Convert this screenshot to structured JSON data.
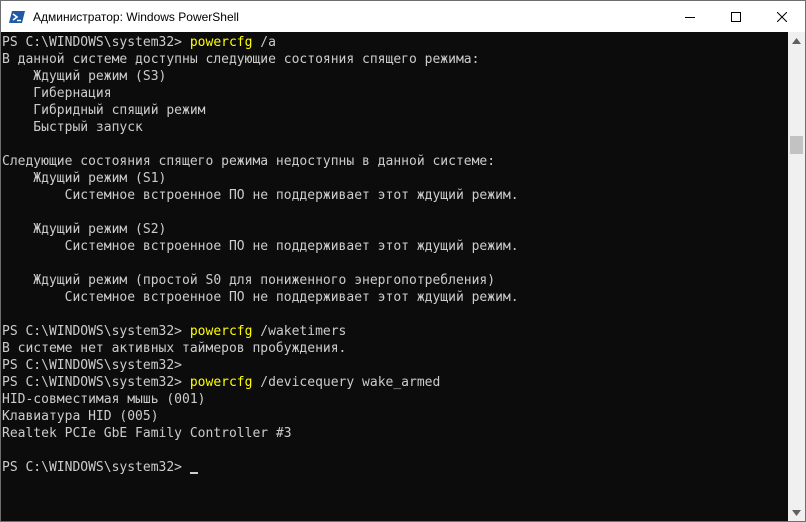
{
  "window": {
    "title": "Администратор: Windows PowerShell",
    "icon": "powershell-icon",
    "controls": [
      "minimize-icon",
      "maximize-icon",
      "close-icon"
    ]
  },
  "console": {
    "prompt": "PS C:\\WINDOWS\\system32> ",
    "lines": [
      {
        "type": "cmd",
        "prompt": "PS C:\\WINDOWS\\system32> ",
        "command": "powercfg",
        "args": " /a"
      },
      {
        "type": "text",
        "text": "В данной системе доступны следующие состояния спящего режима:"
      },
      {
        "type": "text",
        "text": "    Ждущий режим (S3)"
      },
      {
        "type": "text",
        "text": "    Гибернация"
      },
      {
        "type": "text",
        "text": "    Гибридный спящий режим"
      },
      {
        "type": "text",
        "text": "    Быстрый запуск"
      },
      {
        "type": "text",
        "text": ""
      },
      {
        "type": "text",
        "text": "Следующие состояния спящего режима недоступны в данной системе:"
      },
      {
        "type": "text",
        "text": "    Ждущий режим (S1)"
      },
      {
        "type": "text",
        "text": "        Системное встроенное ПО не поддерживает этот ждущий режим."
      },
      {
        "type": "text",
        "text": ""
      },
      {
        "type": "text",
        "text": "    Ждущий режим (S2)"
      },
      {
        "type": "text",
        "text": "        Системное встроенное ПО не поддерживает этот ждущий режим."
      },
      {
        "type": "text",
        "text": ""
      },
      {
        "type": "text",
        "text": "    Ждущий режим (простой S0 для пониженного энергопотребления)"
      },
      {
        "type": "text",
        "text": "        Системное встроенное ПО не поддерживает этот ждущий режим."
      },
      {
        "type": "text",
        "text": ""
      },
      {
        "type": "cmd",
        "prompt": "PS C:\\WINDOWS\\system32> ",
        "command": "powercfg",
        "args": " /waketimers"
      },
      {
        "type": "text",
        "text": "В системе нет активных таймеров пробуждения."
      },
      {
        "type": "text",
        "text": "PS C:\\WINDOWS\\system32>"
      },
      {
        "type": "cmd",
        "prompt": "PS C:\\WINDOWS\\system32> ",
        "command": "powercfg",
        "args": " /devicequery wake_armed"
      },
      {
        "type": "text",
        "text": "HID-совместимая мышь (001)"
      },
      {
        "type": "text",
        "text": "Клавиатура HID (005)"
      },
      {
        "type": "text",
        "text": "Realtek PCIe GbE Family Controller #3"
      },
      {
        "type": "text",
        "text": ""
      },
      {
        "type": "prompt",
        "prompt": "PS C:\\WINDOWS\\system32> "
      }
    ]
  },
  "colors": {
    "background": "#0c0c0c",
    "foreground": "#cccccc",
    "command": "#ffff00"
  },
  "scrollbar": {
    "position": 0.2
  }
}
